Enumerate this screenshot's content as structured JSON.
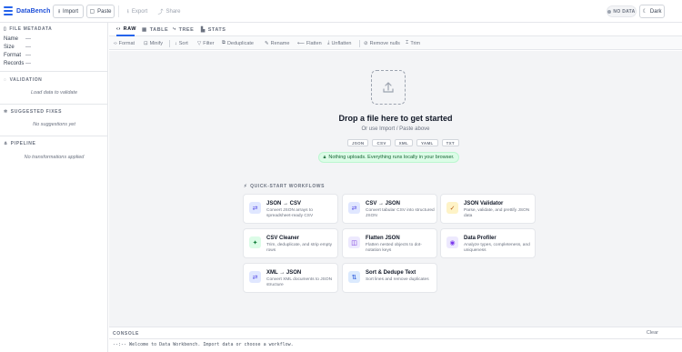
{
  "app": {
    "name": "DataBench"
  },
  "header": {
    "import_label": "Import",
    "paste_label": "Paste",
    "export_label": "Export",
    "share_label": "Share",
    "status_badge": "NO DATA",
    "theme_label": "Dark"
  },
  "sidebar": {
    "file_metadata": {
      "title": "FILE METADATA",
      "rows": [
        {
          "label": "Name",
          "value": "—"
        },
        {
          "label": "Size",
          "value": "—"
        },
        {
          "label": "Format",
          "value": "—"
        },
        {
          "label": "Records",
          "value": "—"
        }
      ]
    },
    "validation": {
      "title": "VALIDATION",
      "empty": "Load data to validate"
    },
    "suggested_fixes": {
      "title": "SUGGESTED FIXES",
      "empty": "No suggestions yet"
    },
    "pipeline": {
      "title": "PIPELINE",
      "empty": "No transformations applied"
    }
  },
  "tabs": [
    {
      "label": "RAW",
      "icon": "code-icon",
      "active": true
    },
    {
      "label": "TABLE",
      "icon": "table-icon",
      "active": false
    },
    {
      "label": "TREE",
      "icon": "tree-icon",
      "active": false
    },
    {
      "label": "STATS",
      "icon": "stats-icon",
      "active": false
    }
  ],
  "toolbar": {
    "format": "Format",
    "minify": "Minify",
    "sort": "Sort",
    "filter": "Filter",
    "deduplicate": "Deduplicate",
    "rename": "Rename",
    "flatten": "Flatten",
    "unflatten": "Unflatten",
    "remove_nulls": "Remove nulls",
    "trim": "Trim"
  },
  "dropzone": {
    "title": "Drop a file here to get started",
    "subtitle": "Or use Import / Paste above",
    "formats": [
      "JSON",
      "CSV",
      "XML",
      "YAML",
      "TXT"
    ],
    "privacy": "Nothing uploads. Everything runs locally in your browser."
  },
  "quickstart": {
    "title": "QUICK-START WORKFLOWS",
    "cards": [
      {
        "title": "JSON → CSV",
        "desc": "Convert JSON arrays to spreadsheet-ready CSV",
        "icon": "arrows-icon",
        "color": "#e0e7ff"
      },
      {
        "title": "CSV → JSON",
        "desc": "Convert tabular CSV into structured JSON",
        "icon": "arrows-icon",
        "color": "#e0e7ff"
      },
      {
        "title": "JSON Validator",
        "desc": "Parse, validate, and prettify JSON data",
        "icon": "check-icon",
        "color": "#fef3c7"
      },
      {
        "title": "CSV Cleaner",
        "desc": "Trim, deduplicate, and strip empty rows",
        "icon": "sparkle-icon",
        "color": "#dcfce7"
      },
      {
        "title": "Flatten JSON",
        "desc": "Flatten nested objects to dot-notation keys",
        "icon": "layers-icon",
        "color": "#ede9fe"
      },
      {
        "title": "Data Profiler",
        "desc": "Analyze types, completeness, and uniqueness",
        "icon": "profile-icon",
        "color": "#ede9fe"
      },
      {
        "title": "XML → JSON",
        "desc": "Convert XML documents to JSON structure",
        "icon": "arrows-icon",
        "color": "#e0e7ff"
      },
      {
        "title": "Sort & Dedupe Text",
        "desc": "Sort lines and remove duplicates",
        "icon": "sort-icon",
        "color": "#dbeafe"
      }
    ]
  },
  "console": {
    "title": "CONSOLE",
    "clear_label": "Clear",
    "lines": [
      "--:-- Welcome to Data Workbench. Import data or choose a workflow."
    ]
  },
  "colors": {
    "accent": "#2563eb",
    "success_bg": "#dcfce7",
    "success_text": "#166534"
  }
}
